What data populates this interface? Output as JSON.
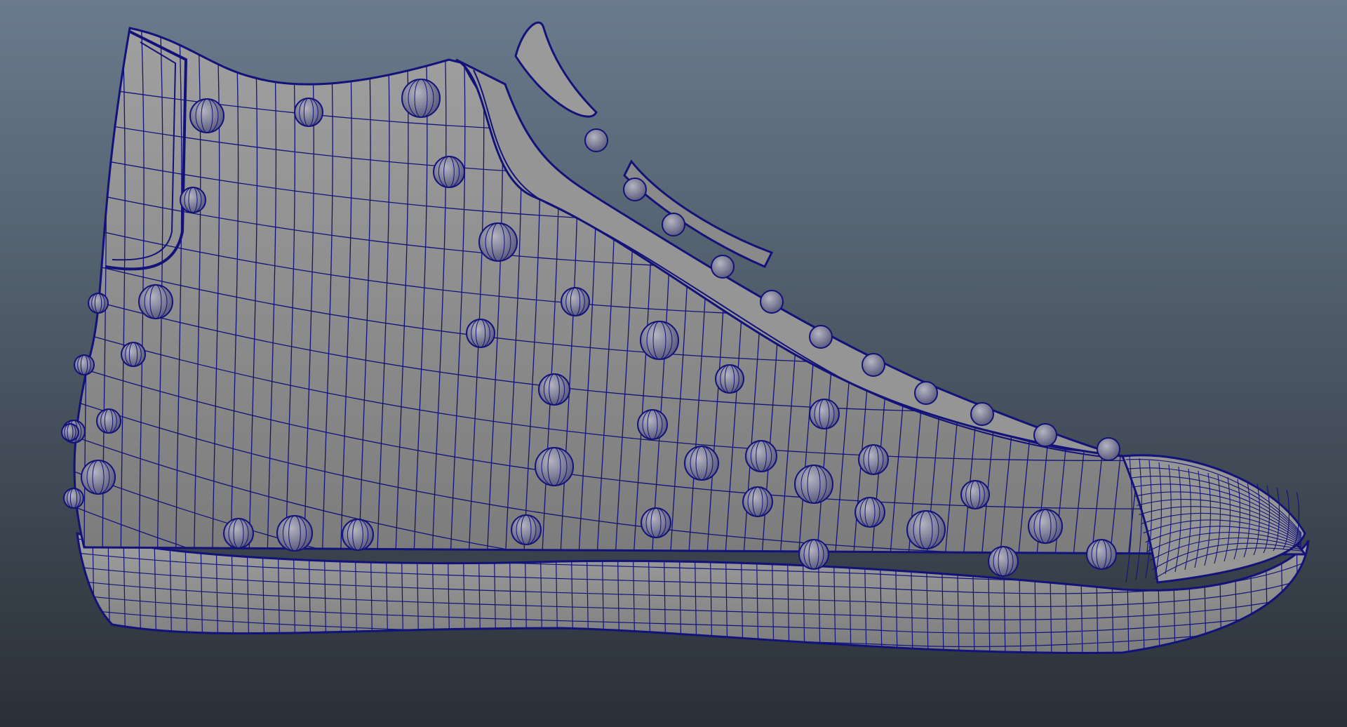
{
  "viewport": {
    "background_top": "#6a7b8d",
    "background_bottom": "#2a3038"
  },
  "model": {
    "shading": "wireframe-on-shaded",
    "surface_color": "#8e8e8e",
    "wire_color": "#12127a"
  }
}
